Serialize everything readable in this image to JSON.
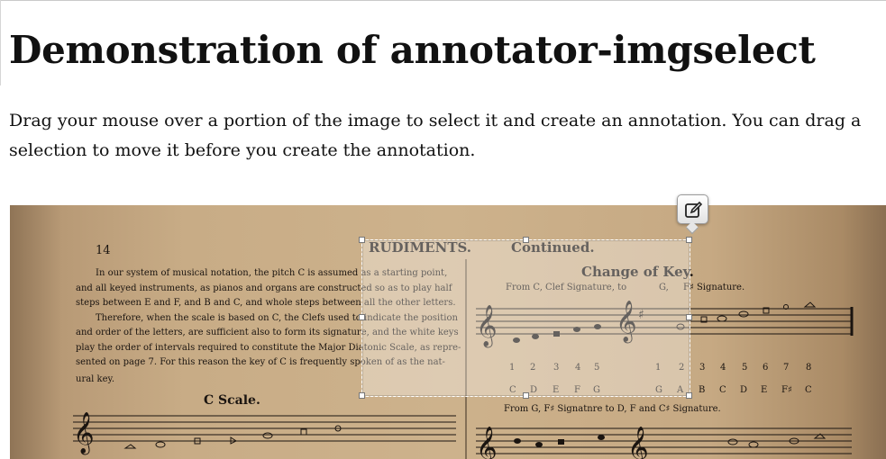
{
  "page": {
    "title": "Demonstration of annotator-imgselect",
    "intro": "Drag your mouse over a portion of the image to select it and create an annotation. You can drag a selection to move it before you create the annotation."
  },
  "image": {
    "page_number": "14",
    "heading_left": "RUDIMENTS.",
    "heading_right": "Continued.",
    "body_lines": [
      "In our system of musical notation, the pitch C is assumed as a starting point,",
      "and all keyed instruments, as pianos and organs are constructed so as to play half",
      "steps between E and F, and B and C, and whole steps between all the other letters.",
      "Therefore, when the scale is based on C, the Clefs used to indicate the position",
      "and order of the letters, are sufficient also to form its signature, and the white keys",
      "play the order of intervals required to constitute the Major Diatonic Scale, as repre-",
      "sented on page 7.  For this reason the key of C is frequently spoken of as the nat-",
      "ural key."
    ],
    "c_scale_title": "C Scale.",
    "change_of_key_title": "Change of Key.",
    "caption_top": "From C, Clef Signature, to",
    "caption_top_g": "G,",
    "caption_top_sig": "F♯ Signature.",
    "caption_bottom": "From G, F♯ Signatnre to D, F and C♯ Signature.",
    "numbers_left": [
      "1",
      "2",
      "3",
      "4",
      "5"
    ],
    "letters_left": [
      "C",
      "D",
      "E",
      "F",
      "G"
    ],
    "numbers_right": [
      "1",
      "2",
      "3",
      "4",
      "5",
      "6",
      "7",
      "8"
    ],
    "letters_right": [
      "G",
      "A",
      "B",
      "C",
      "D",
      "E",
      "F♯",
      "C"
    ]
  },
  "annotate_button": {
    "icon": "edit-icon"
  },
  "colors": {
    "paper": "#cdb28c",
    "ink": "#1a1410",
    "selection_overlay": "rgba(255,255,255,0.35)"
  }
}
